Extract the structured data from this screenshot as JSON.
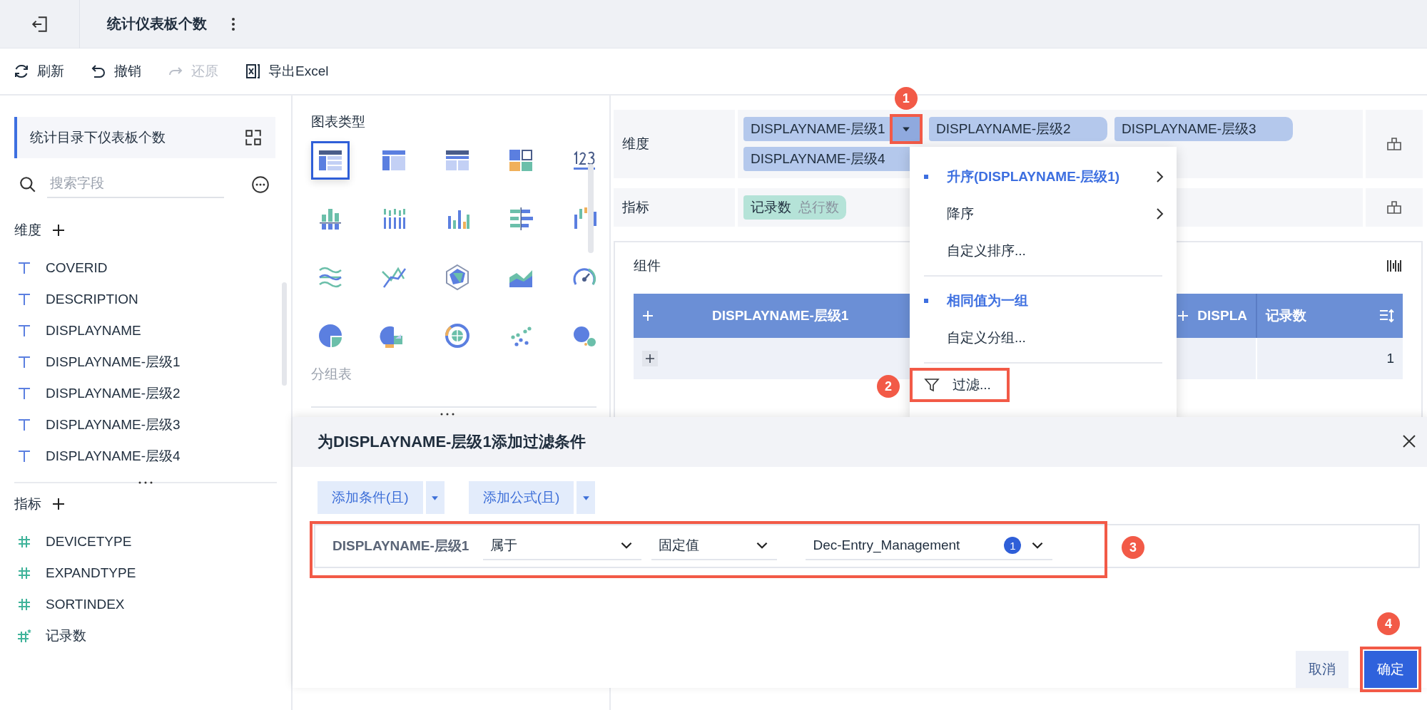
{
  "header": {
    "title": "统计仪表板个数"
  },
  "toolbar": [
    {
      "label": "刷新",
      "kind": "refresh",
      "disabled": false
    },
    {
      "label": "撤销",
      "kind": "undo",
      "disabled": false
    },
    {
      "label": "还原",
      "kind": "redo",
      "disabled": true
    },
    {
      "label": "导出Excel",
      "kind": "excel",
      "disabled": false
    }
  ],
  "sidebar": {
    "dataset": "统计目录下仪表板个数",
    "search": {
      "placeholder": "搜索字段"
    },
    "dimensions": {
      "title": "维度",
      "fields": [
        {
          "name": "COVERID",
          "kind": "text"
        },
        {
          "name": "DESCRIPTION",
          "kind": "text"
        },
        {
          "name": "DISPLAYNAME",
          "kind": "text"
        },
        {
          "name": "DISPLAYNAME-层级1",
          "kind": "text"
        },
        {
          "name": "DISPLAYNAME-层级2",
          "kind": "text"
        },
        {
          "name": "DISPLAYNAME-层级3",
          "kind": "text"
        },
        {
          "name": "DISPLAYNAME-层级4",
          "kind": "text"
        }
      ]
    },
    "measures": {
      "title": "指标",
      "fields": [
        {
          "name": "DEVICETYPE",
          "kind": "number"
        },
        {
          "name": "EXPANDTYPE",
          "kind": "number"
        },
        {
          "name": "SORTINDEX",
          "kind": "number"
        },
        {
          "name": "记录数",
          "kind": "calculated"
        }
      ]
    }
  },
  "chart_types": {
    "title": "图表类型",
    "types": [
      {
        "kind": "group-table",
        "selected": true
      },
      {
        "kind": "cross-table",
        "selected": false
      },
      {
        "kind": "detail-table",
        "selected": false
      },
      {
        "kind": "blocks",
        "selected": false
      },
      {
        "kind": "number",
        "selected": false
      },
      {
        "kind": "stacked-bar",
        "selected": false
      },
      {
        "kind": "multi-bar",
        "selected": false
      },
      {
        "kind": "bar",
        "selected": false
      },
      {
        "kind": "horizontal-bar",
        "selected": false
      },
      {
        "kind": "waterfall",
        "selected": false
      },
      {
        "kind": "wave",
        "selected": false
      },
      {
        "kind": "cross-line",
        "selected": false
      },
      {
        "kind": "radar",
        "selected": false
      },
      {
        "kind": "area",
        "selected": false
      },
      {
        "kind": "gauge",
        "selected": false
      },
      {
        "kind": "pie",
        "selected": false
      },
      {
        "kind": "rose",
        "selected": false
      },
      {
        "kind": "sunburst",
        "selected": false
      },
      {
        "kind": "scatter",
        "selected": false
      },
      {
        "kind": "bubble",
        "selected": false
      }
    ],
    "caption": "分组表"
  },
  "config": {
    "rows": [
      {
        "label": "维度",
        "chips": [
          {
            "name": "DISPLAYNAME-层级1",
            "kind": "dimension",
            "menu_open": true,
            "step": "1"
          },
          {
            "name": "DISPLAYNAME-层级2",
            "kind": "dimension",
            "menu_open": false
          },
          {
            "name": "DISPLAYNAME-层级3",
            "kind": "dimension",
            "menu_open": false
          },
          {
            "name": "DISPLAYNAME-层级4",
            "kind": "dimension",
            "menu_open": false
          }
        ]
      },
      {
        "label": "指标",
        "chips": [
          {
            "name": "记录数",
            "note": "总行数",
            "kind": "measure",
            "menu_open": false
          }
        ]
      }
    ]
  },
  "component": {
    "title": "组件",
    "table": {
      "columns": [
        {
          "label": "DISPLAYNAME-层级1",
          "expand": true,
          "sort": false
        },
        {
          "label": "DISPLA",
          "expand": true,
          "sort": false
        },
        {
          "label": "记录数",
          "expand": false,
          "sort": true
        }
      ],
      "rows": [
        {
          "value": "1"
        }
      ]
    }
  },
  "menu": {
    "items": [
      {
        "kind": "option",
        "label": "升序(DISPLAYNAME-层级1)",
        "selected": true,
        "submenu": true
      },
      {
        "kind": "option",
        "label": "降序",
        "selected": false,
        "submenu": true
      },
      {
        "kind": "option",
        "label": "自定义排序...",
        "selected": false,
        "submenu": false
      },
      {
        "kind": "divider"
      },
      {
        "kind": "option",
        "label": "相同值为一组",
        "selected": true,
        "submenu": false
      },
      {
        "kind": "option",
        "label": "自定义分组...",
        "selected": false,
        "submenu": false
      },
      {
        "kind": "divider"
      },
      {
        "kind": "filter",
        "label": "过滤...",
        "step": "2"
      }
    ]
  },
  "dialog": {
    "title": "为DISPLAYNAME-层级1添加过滤条件",
    "actions": [
      {
        "label": "添加条件(且)"
      },
      {
        "label": "添加公式(且)"
      }
    ],
    "condition": {
      "field": "DISPLAYNAME-层级1",
      "operator": "属于",
      "value_type": "固定值",
      "value": "Dec-Entry_Management",
      "count": "1",
      "step": "3"
    },
    "buttons": [
      {
        "label": "取消",
        "kind": "secondary"
      },
      {
        "label": "确定",
        "kind": "primary",
        "step": "4"
      }
    ]
  }
}
